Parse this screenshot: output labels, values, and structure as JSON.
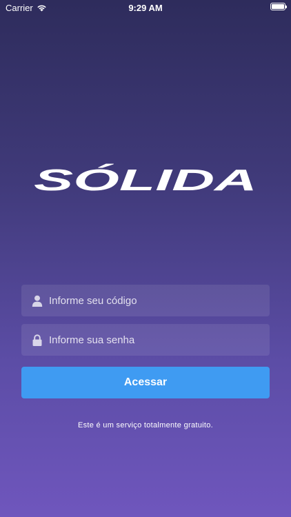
{
  "status_bar": {
    "carrier": "Carrier",
    "time": "9:29 AM",
    "wifi_icon": "wifi-icon",
    "battery_icon": "battery-icon"
  },
  "brand": {
    "logo_text": "SÓLIDA"
  },
  "login_form": {
    "code_field": {
      "icon": "user-icon",
      "placeholder": "Informe seu código",
      "value": ""
    },
    "password_field": {
      "icon": "lock-icon",
      "placeholder": "Informe sua senha",
      "value": ""
    },
    "submit_label": "Acessar"
  },
  "footer": {
    "note": "Este é um serviço totalmente gratuito."
  },
  "colors": {
    "background_top": "#2e2c5c",
    "background_bottom": "#6f56bd",
    "button": "#3f9bf2",
    "text": "#ffffff"
  }
}
